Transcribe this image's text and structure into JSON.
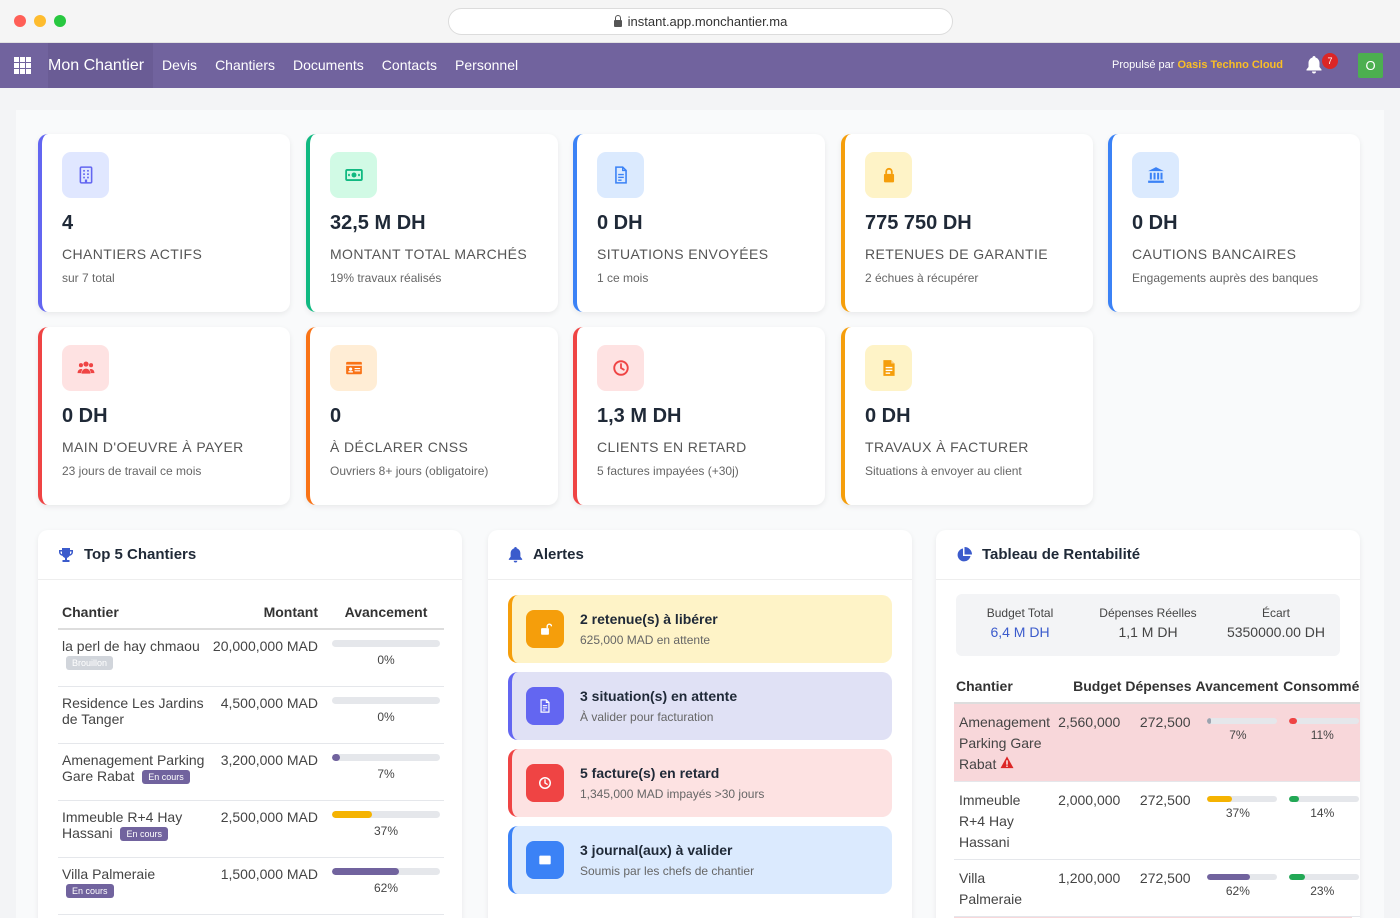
{
  "browser": {
    "url": "instant.app.monchantier.ma"
  },
  "nav": {
    "brand": "Mon Chantier",
    "items": [
      "Devis",
      "Chantiers",
      "Documents",
      "Contacts",
      "Personnel"
    ],
    "powered_prefix": "Propulsé par",
    "powered_brand": "Oasis Techno Cloud",
    "notif_count": "7",
    "avatar": "O"
  },
  "kpis": [
    {
      "value": "4",
      "label": "CHANTIERS ACTIFS",
      "sub": "sur 7 total",
      "icon": "building-icon",
      "color": "#6366f1",
      "bg": "#e0e7ff"
    },
    {
      "value": "32,5 M DH",
      "label": "MONTANT TOTAL MARCHÉS",
      "sub": "19% travaux réalisés",
      "icon": "money-icon",
      "color": "#10b981",
      "bg": "#d1fae5"
    },
    {
      "value": "0 DH",
      "label": "SITUATIONS ENVOYÉES",
      "sub": "1 ce mois",
      "icon": "document-icon",
      "color": "#3b82f6",
      "bg": "#dbeafe"
    },
    {
      "value": "775 750 DH",
      "label": "RETENUES DE GARANTIE",
      "sub": "2 échues à récupérer",
      "icon": "lock-icon",
      "color": "#f59e0b",
      "bg": "#fef3c7"
    },
    {
      "value": "0 DH",
      "label": "CAUTIONS BANCAIRES",
      "sub": "Engagements auprès des banques",
      "icon": "bank-icon",
      "color": "#3b82f6",
      "bg": "#dbeafe"
    },
    {
      "value": "0 DH",
      "label": "MAIN D'OEUVRE À PAYER",
      "sub": "23 jours de travail ce mois",
      "icon": "users-icon",
      "color": "#ef4444",
      "bg": "#fee2e2"
    },
    {
      "value": "0",
      "label": "À DÉCLARER CNSS",
      "sub": "Ouvriers 8+ jours (obligatoire)",
      "icon": "id-card-icon",
      "color": "#f97316",
      "bg": "#ffedd5"
    },
    {
      "value": "1,3 M DH",
      "label": "CLIENTS EN RETARD",
      "sub": "5 factures impayées (+30j)",
      "icon": "clock-icon",
      "color": "#ef4444",
      "bg": "#fee2e2"
    },
    {
      "value": "0 DH",
      "label": "TRAVAUX À FACTURER",
      "sub": "Situations à envoyer au client",
      "icon": "invoice-icon",
      "color": "#f59e0b",
      "bg": "#fef3c7"
    }
  ],
  "top5": {
    "title": "Top 5 Chantiers",
    "headers": [
      "Chantier",
      "Montant",
      "Avancement"
    ],
    "rows": [
      {
        "name": "la perl de hay chmaou",
        "tag": "Brouillon",
        "tag_color": "#d1d5db",
        "amount": "20,000,000 MAD",
        "progress": 0,
        "pct": "0%",
        "bar": "#9ca3af"
      },
      {
        "name": "Residence Les Jardins de Tanger",
        "tag": "",
        "tag_color": "",
        "amount": "4,500,000 MAD",
        "progress": 0,
        "pct": "0%",
        "bar": "#9ca3af"
      },
      {
        "name": "Amenagement Parking Gare Rabat",
        "tag": "En cours",
        "tag_color": "#71639e",
        "amount": "3,200,000 MAD",
        "progress": 7,
        "pct": "7%",
        "bar": "#71639e"
      },
      {
        "name": "Immeuble R+4 Hay Hassani",
        "tag": "En cours",
        "tag_color": "#71639e",
        "amount": "2,500,000 MAD",
        "progress": 37,
        "pct": "37%",
        "bar": "#f5b301"
      },
      {
        "name": "Villa Palmeraie",
        "tag": "En cours",
        "tag_color": "#71639e",
        "amount": "1,500,000 MAD",
        "progress": 62,
        "pct": "62%",
        "bar": "#71639e"
      }
    ]
  },
  "alerts": {
    "title": "Alertes",
    "items": [
      {
        "title": "2 retenue(s) à libérer",
        "sub": "625,000 MAD en attente",
        "bg": "#fef3c7",
        "border": "#f59e0b",
        "icon_bg": "#f59e0b",
        "icon": "unlock-icon"
      },
      {
        "title": "3 situation(s) en attente",
        "sub": "À valider pour facturation",
        "bg": "#e0e1f5",
        "border": "#6366f1",
        "icon_bg": "#6366f1",
        "icon": "document-icon"
      },
      {
        "title": "5 facture(s) en retard",
        "sub": "1,345,000 MAD impayés >30 jours",
        "bg": "#fde2e2",
        "border": "#ef4444",
        "icon_bg": "#ef4444",
        "icon": "clock-icon"
      },
      {
        "title": "3 journal(aux) à valider",
        "sub": "Soumis par les chefs de chantier",
        "bg": "#dbeafe",
        "border": "#3b82f6",
        "icon_bg": "#3b82f6",
        "icon": "journal-icon"
      }
    ]
  },
  "rentab": {
    "title": "Tableau de Rentabilité",
    "summary": [
      {
        "label": "Budget Total",
        "value": "6,4 M DH",
        "color": "#3b5bcc"
      },
      {
        "label": "Dépenses Réelles",
        "value": "1,1 M DH",
        "color": "#1f2937"
      },
      {
        "label": "Écart",
        "value": "5350000.00 DH",
        "color": "#1f2937"
      }
    ],
    "headers": [
      "Chantier",
      "Budget",
      "Dépenses",
      "Avancement",
      "Consommé"
    ],
    "rows": [
      {
        "name": "Amenagement Parking Gare Rabat",
        "warn": true,
        "budget": "2,560,000",
        "dep": "272,500",
        "av": 7,
        "av_pct": "7%",
        "av_color": "#9ca3af",
        "co": 11,
        "co_pct": "11%",
        "co_color": "#ef4444",
        "red": true
      },
      {
        "name": "Immeuble R+4 Hay Hassani",
        "warn": false,
        "budget": "2,000,000",
        "dep": "272,500",
        "av": 37,
        "av_pct": "37%",
        "av_color": "#f5b301",
        "co": 14,
        "co_pct": "14%",
        "co_color": "#22a855",
        "red": false
      },
      {
        "name": "Villa Palmeraie",
        "warn": false,
        "budget": "1,200,000",
        "dep": "272,500",
        "av": 62,
        "av_pct": "62%",
        "av_color": "#71639e",
        "co": 23,
        "co_pct": "23%",
        "co_color": "#22a855",
        "red": false
      }
    ]
  }
}
